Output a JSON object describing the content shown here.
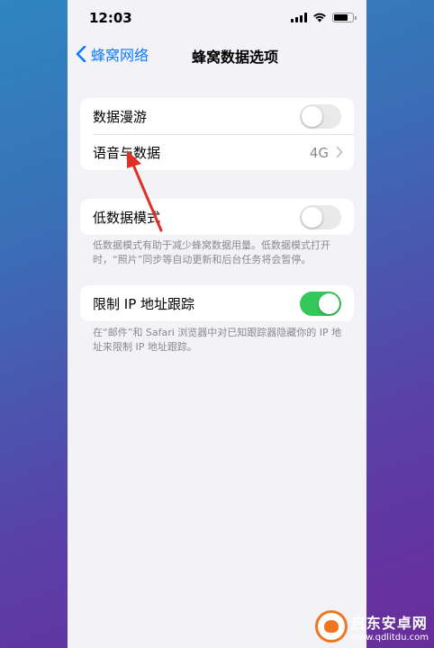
{
  "status_bar": {
    "time": "12:03"
  },
  "nav": {
    "back_label": "蜂窝网络",
    "title": "蜂窝数据选项"
  },
  "group1": {
    "roaming_label": "数据漫游",
    "roaming_on": false,
    "voice_data_label": "语音与数据",
    "voice_data_value": "4G"
  },
  "group2": {
    "low_data_label": "低数据模式",
    "low_data_on": false,
    "footnote": "低数据模式有助于减少蜂窝数据用量。低数据模式打开时，“照片”同步等自动更新和后台任务将会暂停。"
  },
  "group3": {
    "limit_ip_label": "限制 IP 地址跟踪",
    "limit_ip_on": true,
    "footnote": "在“邮件”和 Safari 浏览器中对已知跟踪器隐藏你的 IP 地址来限制 IP 地址跟踪。"
  },
  "watermark": {
    "name": "启东安卓网",
    "url": "www.qdlitdu.com"
  },
  "colors": {
    "accent": "#0a7aff",
    "toggle_on": "#34c759",
    "arrow": "#e02f25"
  }
}
